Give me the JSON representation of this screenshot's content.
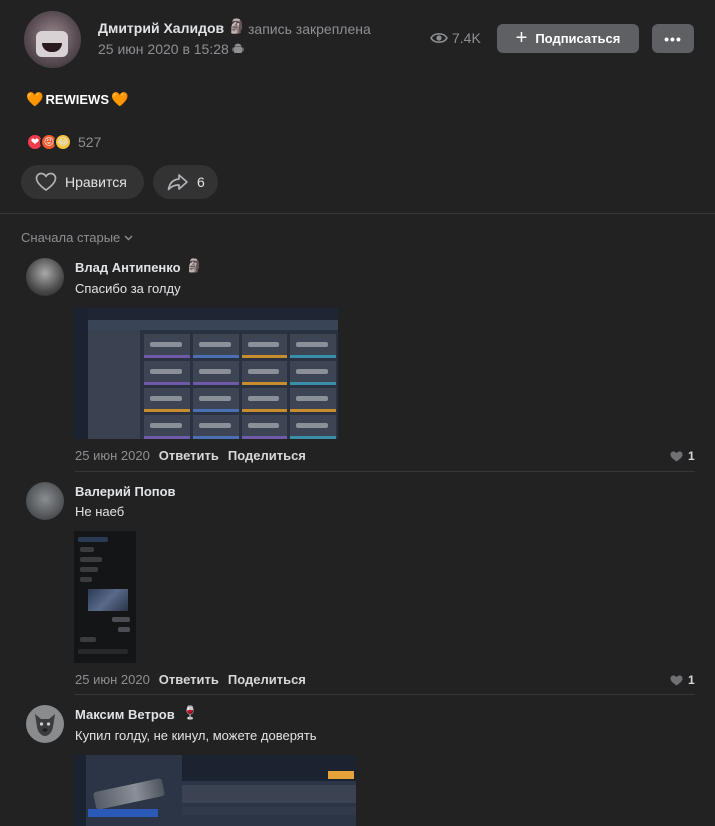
{
  "post": {
    "author_name": "Дмитрий Халидов",
    "author_badge": "🗿",
    "pinned_label": "запись закреплена",
    "date": "25 июн 2020 в 15:28",
    "views": "7.4K",
    "subscribe_label": "Подписаться",
    "more_label": "•••",
    "text": "REWIEWS",
    "text_emoji": "🧡",
    "reactions": [
      "❤",
      "😡",
      "😂"
    ],
    "reactions_count": "527",
    "like_label": "Нравится",
    "share_count": "6"
  },
  "comments_sort": "Сначала старые",
  "comments": [
    {
      "author": "Влад Антипенко",
      "badge": "🗿",
      "text": "Спасибо за голду",
      "date": "25 июн 2020",
      "reply_label": "Ответить",
      "share_label": "Поделиться",
      "likes": "1"
    },
    {
      "author": "Валерий Попов",
      "badge": "",
      "text": "Не наеб",
      "date": "25 июн 2020",
      "reply_label": "Ответить",
      "share_label": "Поделиться",
      "likes": "1"
    },
    {
      "author": "Максим Ветров",
      "badge": "🍷",
      "text": "Купил голду, не кинул, можете доверять"
    }
  ],
  "colors": {
    "background": "#222222",
    "button": "#5f6063",
    "pill": "#333333",
    "muted_text": "#8d8f93",
    "accent_orange": "#ff8a1c"
  }
}
